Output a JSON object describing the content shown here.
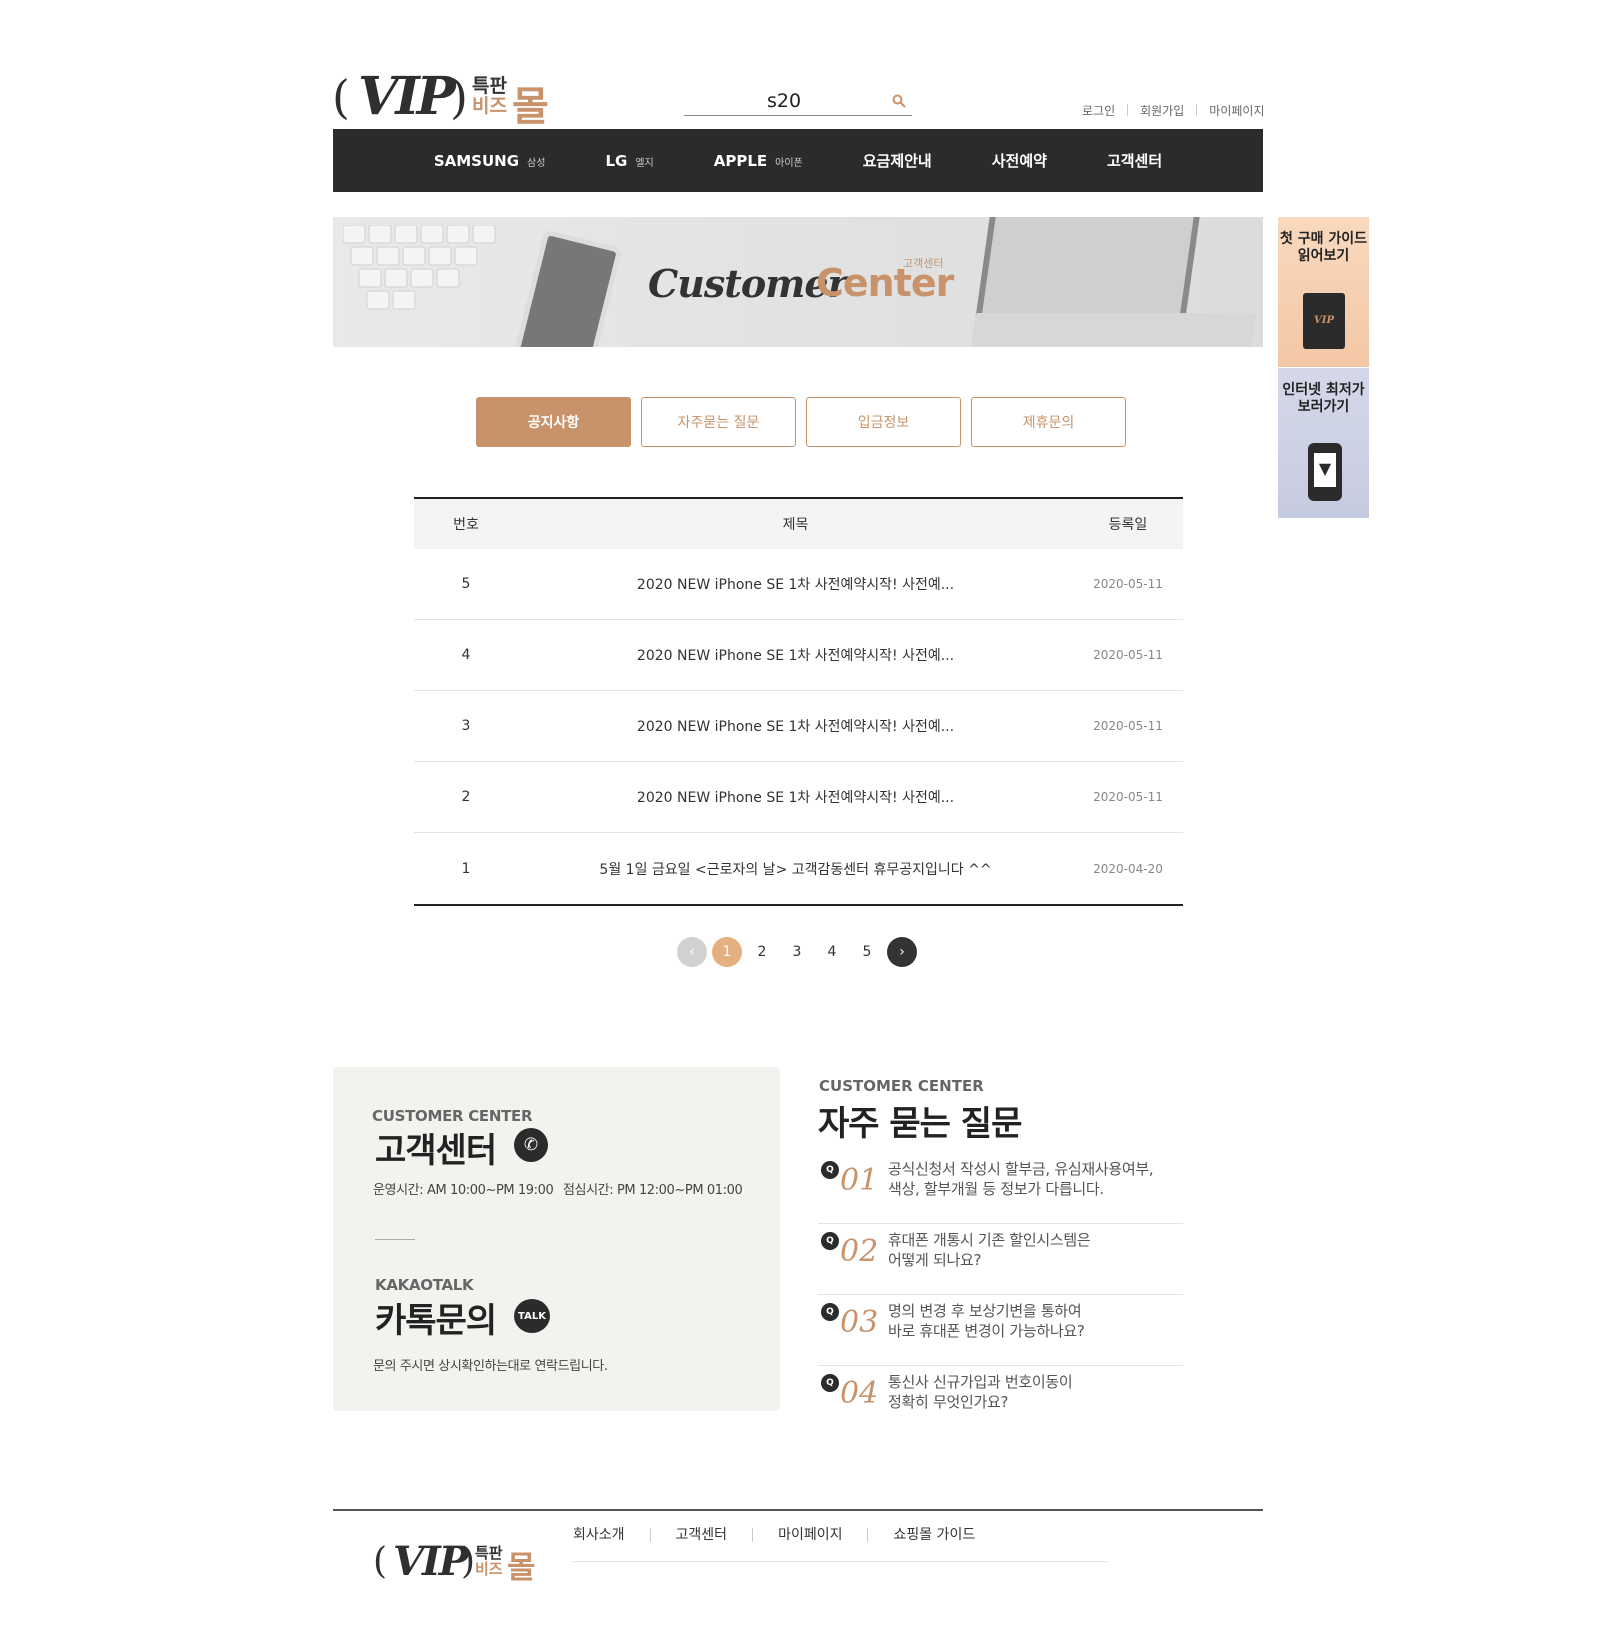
{
  "logo": {
    "main": "VIP",
    "sub1": "특판",
    "sub2": "비즈",
    "mall": "몰"
  },
  "search": {
    "value": "s20"
  },
  "top_links": [
    "로그인",
    "회원가입",
    "마이페이지"
  ],
  "nav": [
    {
      "label": "SAMSUNG",
      "sub": "삼성"
    },
    {
      "label": "LG",
      "sub": "엘지"
    },
    {
      "label": "APPLE",
      "sub": "아이폰"
    },
    {
      "label": "요금제안내",
      "sub": ""
    },
    {
      "label": "사전예약",
      "sub": ""
    },
    {
      "label": "고객센터",
      "sub": ""
    }
  ],
  "banner": {
    "title_dark": "Customer",
    "title_accent": "Center",
    "small": "고객센터"
  },
  "side_banners": [
    {
      "text": "첫 구매 가이드 읽어보기",
      "badge": "VIP"
    },
    {
      "text": "인터넷 최저가 보러가기"
    }
  ],
  "tabs": [
    "공지사항",
    "자주묻는 질문",
    "입금정보",
    "제휴문의"
  ],
  "table": {
    "headers": {
      "num": "번호",
      "title": "제목",
      "date": "등록일"
    },
    "rows": [
      {
        "num": "5",
        "title": "2020 NEW iPhone SE 1차 사전예약시작! 사전예...",
        "date": "2020-05-11"
      },
      {
        "num": "4",
        "title": "2020 NEW iPhone SE 1차 사전예약시작! 사전예...",
        "date": "2020-05-11"
      },
      {
        "num": "3",
        "title": "2020 NEW iPhone SE 1차 사전예약시작! 사전예...",
        "date": "2020-05-11"
      },
      {
        "num": "2",
        "title": "2020 NEW iPhone SE 1차 사전예약시작! 사전예...",
        "date": "2020-05-11"
      },
      {
        "num": "1",
        "title": "5월 1일 금요일 <근로자의 날> 고객감동센터 휴무공지입니다 ^^",
        "date": "2020-04-20"
      }
    ]
  },
  "pagination": {
    "pages": [
      "1",
      "2",
      "3",
      "4",
      "5"
    ],
    "current": "1",
    "prev": "‹",
    "next": "›"
  },
  "cs": {
    "en": "CUSTOMER CENTER",
    "title": "고객센터",
    "hours": "운영시간: AM 10:00~PM 19:00",
    "lunch": "점심시간: PM 12:00~PM 01:00",
    "kakao_en": "KAKAOTALK",
    "kakao_title": "카톡문의",
    "kakao_badge": "TALK",
    "kakao_desc": "문의 주시면 상시확인하는대로 연락드립니다."
  },
  "faq": {
    "en": "CUSTOMER CENTER",
    "title": "자주 묻는 질문",
    "items": [
      {
        "q": "Q",
        "num": "01",
        "line1": "공식신청서 작성시 할부금, 유심재사용여부,",
        "line2": "색상, 할부개월 등 정보가 다릅니다."
      },
      {
        "q": "Q",
        "num": "02",
        "line1": "휴대폰 개통시 기존 할인시스템은",
        "line2": "어떻게 되나요?"
      },
      {
        "q": "Q",
        "num": "03",
        "line1": "명의 변경 후 보상기변을 통하여",
        "line2": "바로 휴대폰 변경이 가능하나요?"
      },
      {
        "q": "Q",
        "num": "04",
        "line1": "통신사 신규가입과 번호이동이",
        "line2": "정확히 무엇인가요?"
      }
    ]
  },
  "footer": {
    "menu": [
      "회사소개",
      "고객센터",
      "마이페이지",
      "쇼핑몰 가이드"
    ]
  },
  "colors": {
    "accent": "#c8936a",
    "dark": "#2b2b2b",
    "pager_current": "#e3b07f"
  }
}
